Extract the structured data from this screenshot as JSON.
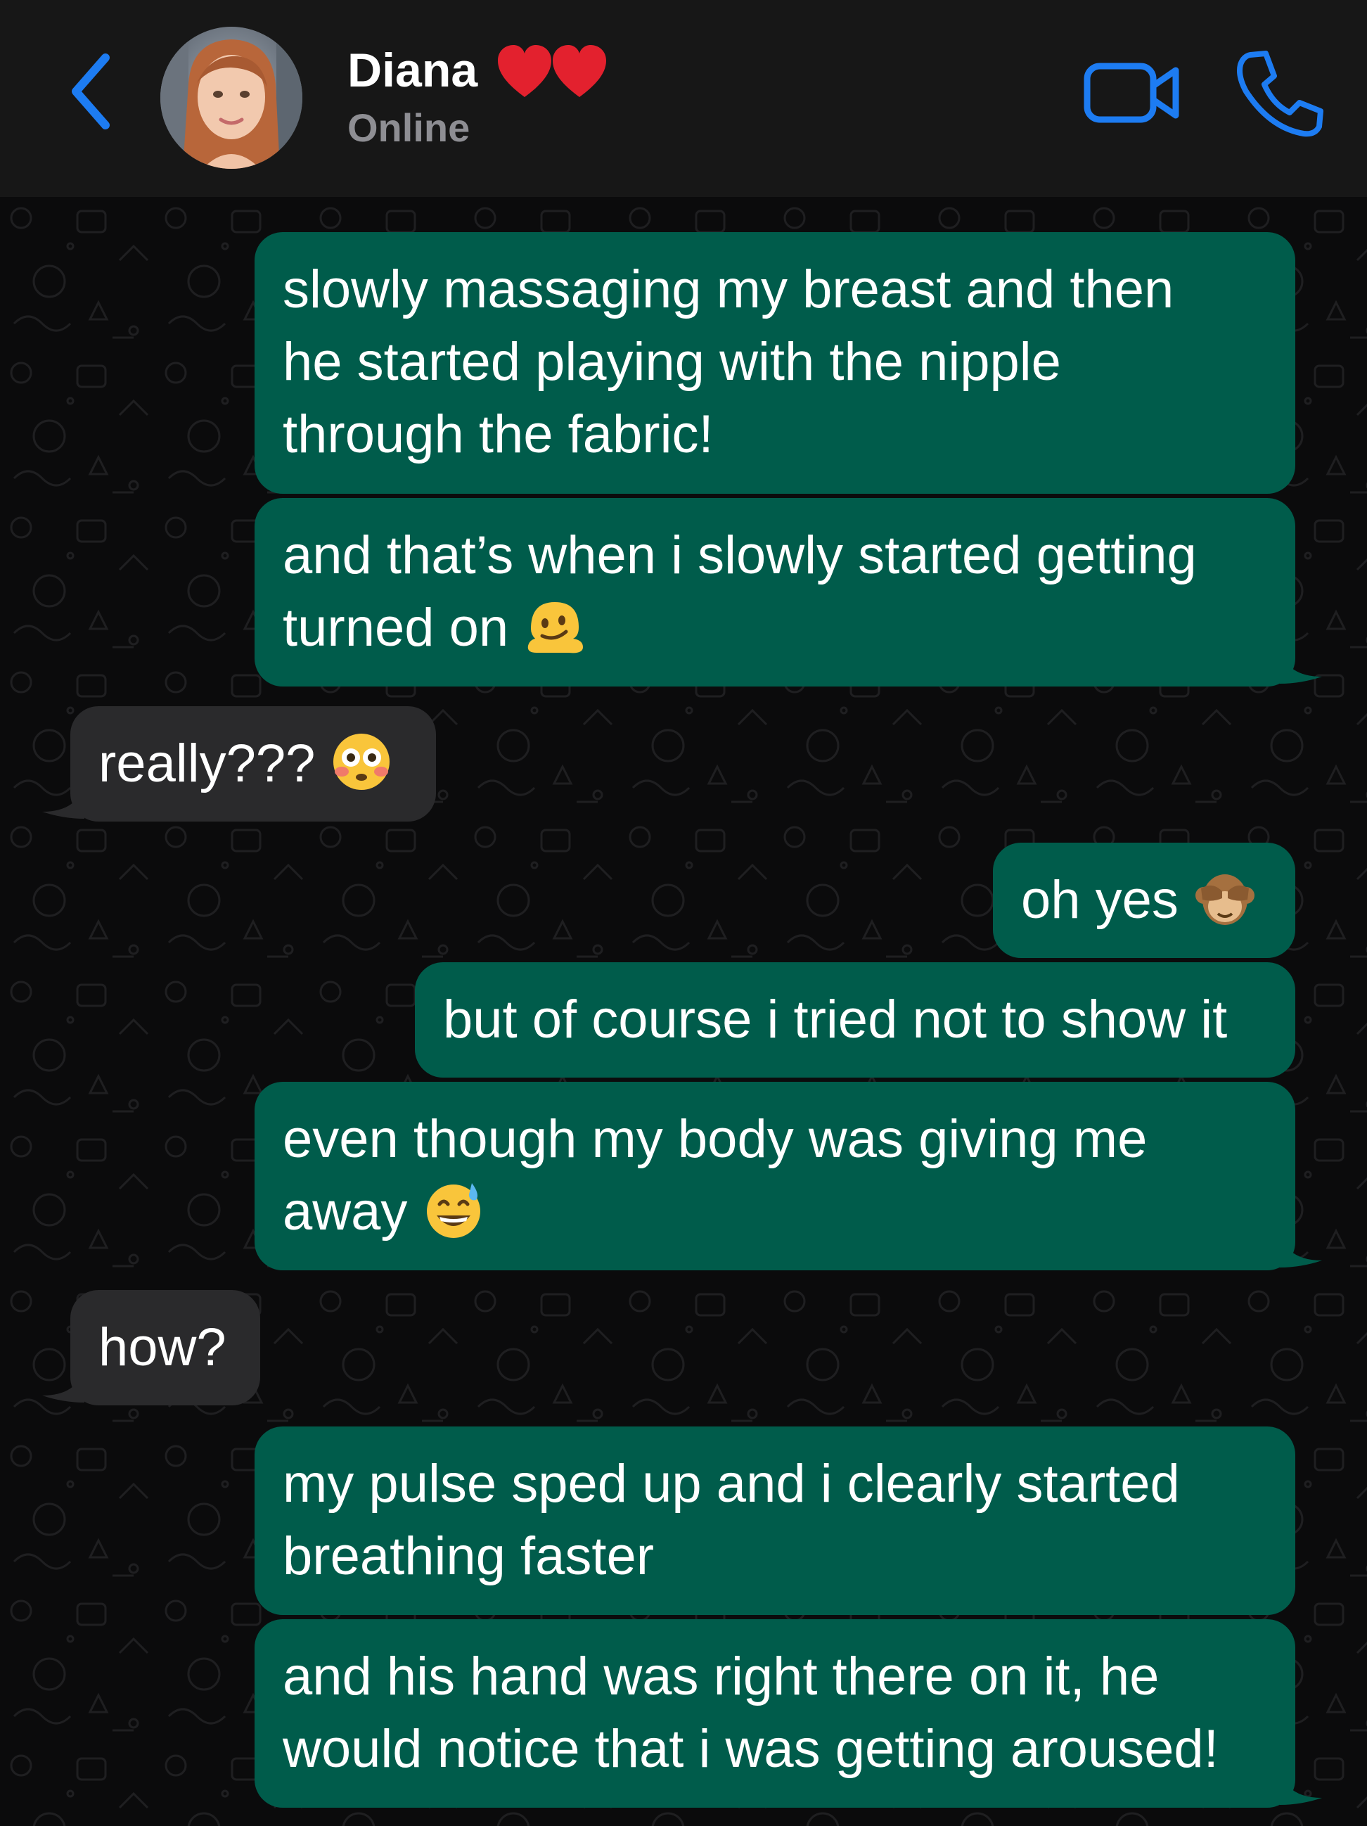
{
  "header": {
    "contact_name": "Diana",
    "name_emoji": "two red hearts",
    "status": "Online",
    "accent_color": "#1d7cf2"
  },
  "icons": {
    "back": "chevron-left-icon",
    "video": "video-camera-icon",
    "call": "phone-icon"
  },
  "messages": [
    {
      "direction": "outgoing",
      "lines": [
        "slowly massaging my breast and then",
        "he started playing with the nipple",
        "through the fabric!"
      ]
    },
    {
      "direction": "outgoing",
      "lines": [
        "and that’s when i slowly started getting",
        "turned on"
      ],
      "emoji": "melting face"
    },
    {
      "direction": "incoming",
      "lines": [
        "really???"
      ],
      "emoji": "flushed face"
    },
    {
      "direction": "outgoing",
      "lines": [
        "oh yes"
      ],
      "emoji": "see-no-evil monkey"
    },
    {
      "direction": "outgoing",
      "lines": [
        "but of course i tried not to show it"
      ]
    },
    {
      "direction": "outgoing",
      "lines": [
        "even though my body was giving me",
        "away"
      ],
      "emoji": "grinning face with sweat"
    },
    {
      "direction": "incoming",
      "lines": [
        "how?"
      ]
    },
    {
      "direction": "outgoing",
      "lines": [
        "my pulse sped up and i clearly started",
        "breathing faster"
      ]
    },
    {
      "direction": "outgoing",
      "lines": [
        "and his hand was right there on it, he",
        "would notice that i was getting aroused!"
      ]
    }
  ],
  "colors": {
    "outgoing_bubble": "#005c4b",
    "incoming_bubble": "#2a2a2c",
    "header_bg": "#171717",
    "chat_bg": "#0b0b0c"
  }
}
